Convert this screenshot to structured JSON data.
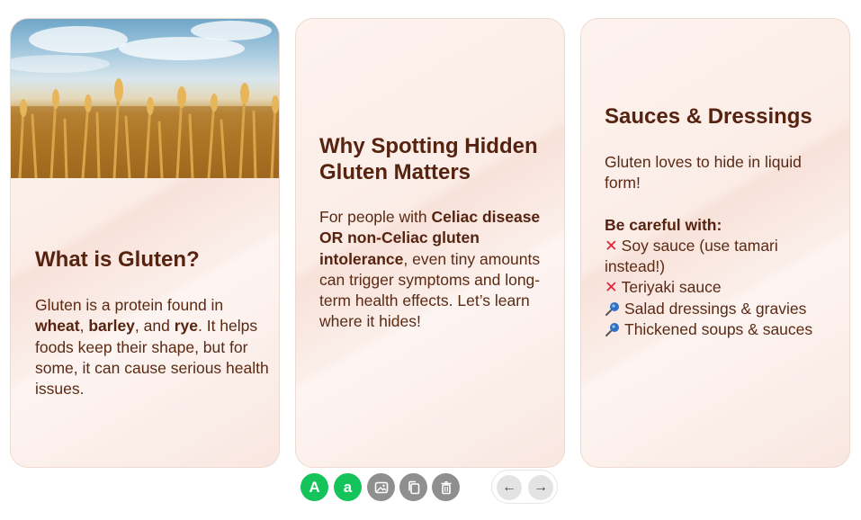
{
  "cards": [
    {
      "title": "What is Gluten?",
      "body": {
        "t1": "Gluten is a protein found in ",
        "b1": "wheat",
        "t2": ", ",
        "b2": "barley",
        "t3": ", and ",
        "b3": "rye",
        "t4": ". It helps foods keep their shape, but for some, it can cause serious health issues."
      }
    },
    {
      "title": "Why Spotting Hidden Gluten Matters",
      "body": {
        "t1": "For people with ",
        "b1": "Celiac disease OR non-Celiac gluten intolerance",
        "t2": ", even tiny amounts can trigger symptoms and long-term health effects. Let’s learn where it hides!"
      }
    },
    {
      "title": "Sauces & Dressings",
      "intro": "Gluten loves to hide in liquid form!",
      "careful_label": "Be careful with:",
      "items": [
        {
          "icon": "cross-mark-icon",
          "text": "Soy sauce (use tamari instead!)"
        },
        {
          "icon": "cross-mark-icon",
          "text": "Teriyaki sauce"
        },
        {
          "icon": "pushpin-icon",
          "text": "Salad dressings & gravies"
        },
        {
          "icon": "pushpin-icon",
          "text": "Thickened soups & sauces"
        }
      ]
    }
  ],
  "toolbar": {
    "a_upper": "A",
    "a_lower": "a"
  },
  "nav": {
    "prev": "←",
    "next": "→"
  },
  "colors": {
    "title": "#55230f",
    "text": "#5a2a14",
    "green": "#14c35a",
    "grey": "#8f8f8f",
    "cross": "#e0243a"
  }
}
